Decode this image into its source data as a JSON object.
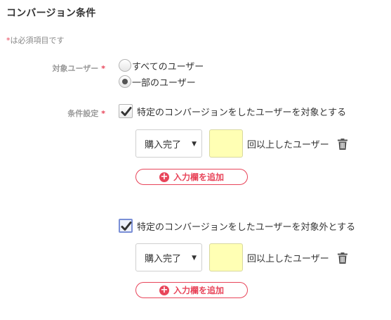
{
  "page": {
    "title": "コンバージョン条件",
    "required_note_star": "*",
    "required_note_text": "は必須項目です"
  },
  "target_users": {
    "label": "対象ユーザー",
    "required_mark": "*",
    "options": [
      {
        "label": "すべてのユーザー",
        "selected": false
      },
      {
        "label": "一部のユーザー",
        "selected": true
      }
    ]
  },
  "condition": {
    "label": "条件設定",
    "required_mark": "*",
    "include": {
      "checked": true,
      "label": "特定のコンバージョンをしたユーザーを対象とする",
      "select_value": "購入完了",
      "count_value": "",
      "suffix": "回以上したユーザー",
      "delete_icon": "trash-icon",
      "add_button_label": "入力欄を追加",
      "add_icon": "plus-circle-icon"
    },
    "exclude": {
      "checked": true,
      "label": "特定のコンバージョンをしたユーザーを対象外とする",
      "select_value": "購入完了",
      "count_value": "",
      "suffix": "回以上したユーザー",
      "delete_icon": "trash-icon",
      "add_button_label": "入力欄を追加",
      "add_icon": "plus-circle-icon"
    }
  },
  "colors": {
    "required": "#e8455a",
    "accent": "#e8455a",
    "input_bg": "#ffffb4",
    "focus_border": "#7a8fd6"
  }
}
